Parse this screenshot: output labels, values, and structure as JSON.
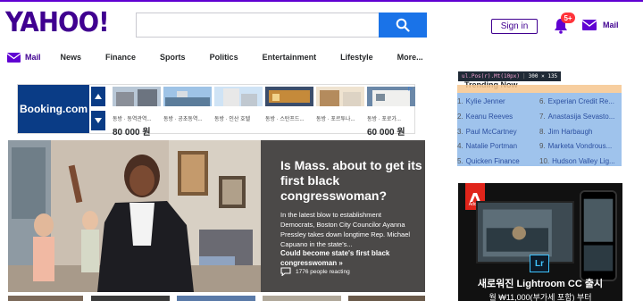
{
  "header": {
    "logo": "YAHOO!",
    "search_placeholder": "",
    "signin_label": "Sign in",
    "notifications_badge": "5+",
    "mail_label": "Mail"
  },
  "nav": {
    "items": [
      "Mail",
      "News",
      "Finance",
      "Sports",
      "Politics",
      "Entertainment",
      "Lifestyle",
      "More..."
    ]
  },
  "ad_banner": {
    "brand": "Booking.com",
    "hotels": [
      {
        "name": "동방 · 동역관역...",
        "price": "80 000 원"
      },
      {
        "name": "동방 · 공초동역...",
        "price": ""
      },
      {
        "name": "동방 · 인산 호텔",
        "price": ""
      },
      {
        "name": "동방 · 스탄프드...",
        "price": ""
      },
      {
        "name": "동방 · 포르투나...",
        "price": ""
      },
      {
        "name": "동방 · 포로가...",
        "price": "60 000 원"
      }
    ]
  },
  "hero": {
    "title": "Is Mass. about to get its first black congresswoman?",
    "summary": "In the latest blow to establishment Democrats, Boston City Councilor Ayanna Pressley takes down longtime Rep. Michael Capuano in the state's...",
    "subheadline": "Could become state's first black congresswoman »",
    "reactions": "1776 people reacting"
  },
  "trending": {
    "title": "Trending Now",
    "tooltip": {
      "selector": "ul.Pos(r).Mt(10px)",
      "size": "300 × 135"
    },
    "items": [
      "Kylie Jenner",
      "Keanu Reeves",
      "Paul McCartney",
      "Natalie Portman",
      "Quicken Finance",
      "Experian Credit Re...",
      "Anastasija Sevasto...",
      "Jim Harbaugh",
      "Marketa Vondrous...",
      "Hudson Valley Lig..."
    ]
  },
  "ad_right": {
    "brand": "Adobe",
    "product_abbr": "Lr",
    "headline": "새로워진 Lightroom CC 출시",
    "subline": "월 ₩11,000(부가세 포함) 부터"
  },
  "colors": {
    "brand": "#400090",
    "search_button": "#1a73e8",
    "booking": "#0a3c86",
    "trend_highlight": "#9fc3ec"
  }
}
